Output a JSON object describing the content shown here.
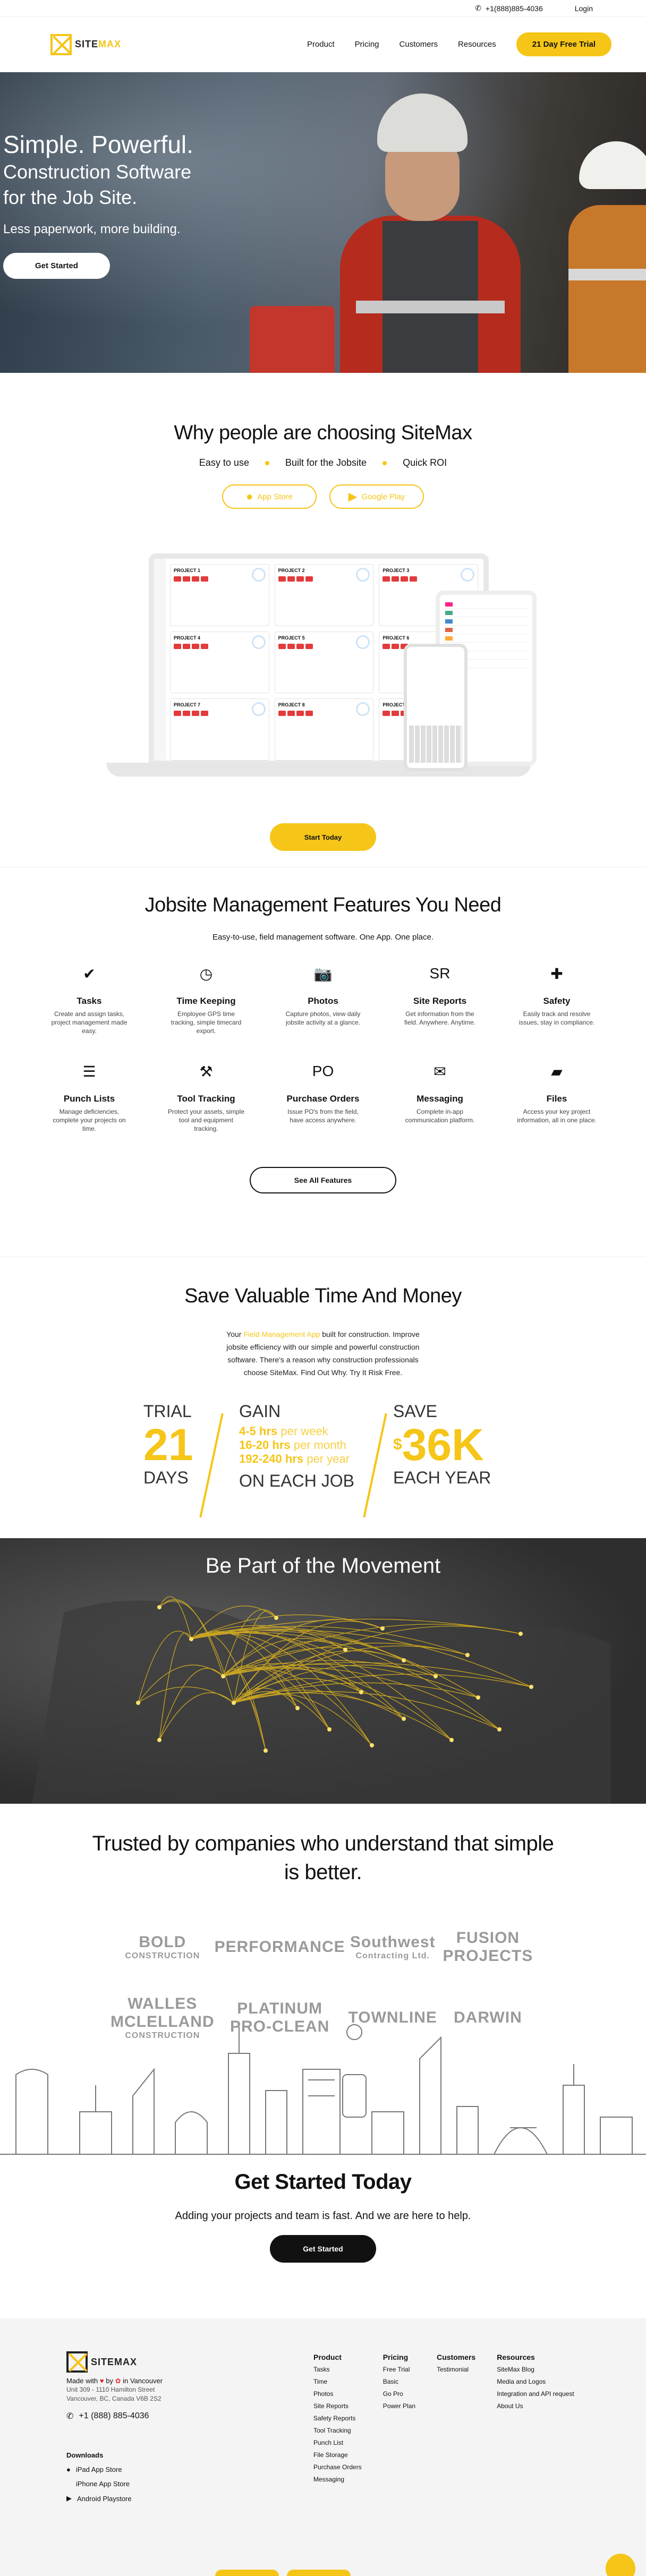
{
  "topbar": {
    "phone": "+1(888)885-4036",
    "login": "Login"
  },
  "nav": {
    "logo_text_a": "SITE",
    "logo_text_b": "MAX",
    "items": [
      "Product",
      "Pricing",
      "Customers",
      "Resources"
    ],
    "cta": "21 Day Free Trial"
  },
  "hero": {
    "title": "Simple. Powerful.",
    "subtitle_1": "Construction Software",
    "subtitle_2": "for the Job Site.",
    "tagline": "Less paperwork, more building.",
    "cta": "Get Started"
  },
  "why": {
    "title": "Why people are choosing SiteMax",
    "bullets": [
      "Easy to use",
      "Built for the Jobsite",
      "Quick ROI"
    ],
    "stores": [
      {
        "icon": "apple-icon",
        "label": "App Store"
      },
      {
        "icon": "google-play-icon",
        "label": "Google Play"
      }
    ],
    "project_cards": [
      "PROJECT 1",
      "PROJECT 2",
      "PROJECT 3",
      "PROJECT 4",
      "PROJECT 5",
      "PROJECT 6",
      "PROJECT 7",
      "PROJECT 8",
      "PROJECT 9"
    ],
    "cta": "Start Today"
  },
  "features": {
    "title": "Jobsite Management Features You Need",
    "lead": "Easy-to-use, field management software. One App. One place.",
    "items": [
      {
        "icon": "tasks-icon",
        "glyph": "✔",
        "name": "Tasks",
        "desc": "Create and assign tasks, project management made easy."
      },
      {
        "icon": "clock-icon",
        "glyph": "◷",
        "name": "Time Keeping",
        "desc": "Employee GPS time tracking, simple timecard export."
      },
      {
        "icon": "camera-icon",
        "glyph": "📷",
        "name": "Photos",
        "desc": "Capture photos, view daily jobsite activity at a glance."
      },
      {
        "icon": "site-reports-icon",
        "glyph": "SR",
        "name": "Site Reports",
        "desc": "Get information from the field. Anywhere. Anytime."
      },
      {
        "icon": "safety-icon",
        "glyph": "✚",
        "name": "Safety",
        "desc": "Easily track and resolve issues, stay in compliance."
      },
      {
        "icon": "punch-list-icon",
        "glyph": "☰",
        "name": "Punch Lists",
        "desc": "Manage deficiencies, complete your projects on time."
      },
      {
        "icon": "drill-icon",
        "glyph": "⚒",
        "name": "Tool Tracking",
        "desc": "Protect your assets, simple tool and equipment tracking."
      },
      {
        "icon": "purchase-order-icon",
        "glyph": "PO",
        "name": "Purchase Orders",
        "desc": "Issue PO's from the field, have access anywhere."
      },
      {
        "icon": "chat-icon",
        "glyph": "✉",
        "name": "Messaging",
        "desc": "Complete in-app communication platform."
      },
      {
        "icon": "folder-icon",
        "glyph": "▰",
        "name": "Files",
        "desc": "Access your key project information, all in one place."
      }
    ],
    "cta": "See All Features"
  },
  "save": {
    "title": "Save Valuable Time And Money",
    "para_pre": "Your ",
    "para_link": "Field Management App",
    "para_post": " built for construction. Improve jobsite efficiency with our simple and powerful construction software. There's a reason why construction professionals choose SiteMax. Find Out Why. Try It Risk Free.",
    "trial": {
      "label": "TRIAL",
      "value": "21",
      "foot": "DAYS"
    },
    "gain": {
      "label": "GAIN",
      "lines": [
        [
          "4-5 hrs",
          "per week"
        ],
        [
          "16-20 hrs",
          "per month"
        ],
        [
          "192-240 hrs",
          "per year"
        ]
      ],
      "foot": "ON EACH JOB"
    },
    "save": {
      "label": "SAVE",
      "currency": "$",
      "value": "36K",
      "foot": "EACH YEAR"
    }
  },
  "movement": {
    "title": "Be Part of the Movement"
  },
  "trusted": {
    "title": "Trusted by companies who understand that simple is better.",
    "logos": [
      {
        "name": "BOLD",
        "sub": "CONSTRUCTION"
      },
      {
        "name": "PERFORMANCE",
        "sub": ""
      },
      {
        "name": "Southwest",
        "sub": "Contracting Ltd."
      },
      {
        "name": "FUSION PROJECTS",
        "sub": ""
      },
      {
        "name": "WALLES MCLELLAND",
        "sub": "CONSTRUCTION"
      },
      {
        "name": "PLATINUM PRO-CLEAN",
        "sub": ""
      },
      {
        "name": "TOWNLINE",
        "sub": ""
      },
      {
        "name": "DARWIN",
        "sub": ""
      }
    ]
  },
  "getstarted": {
    "title": "Get Started Today",
    "text": "Adding your projects and team is fast. And we are here to help.",
    "cta": "Get Started"
  },
  "footer": {
    "made": "Made with",
    "by": "by",
    "in": "in Vancouver",
    "addr_1": "Unit 309 - 1110 Hamilton Street",
    "addr_2": "Vancouver, BC, Canada V6B 2S2",
    "phone": "+1 (888) 885-4036",
    "downloads_title": "Downloads",
    "downloads": [
      "iPad App Store",
      "iPhone App Store",
      "Android Playstore"
    ],
    "columns": [
      {
        "title": "Product",
        "links": [
          "Tasks",
          "Time",
          "Photos",
          "Site Reports",
          "Safety Reports",
          "Tool Tracking",
          "Punch List",
          "File Storage",
          "Purchase Orders",
          "Messaging"
        ]
      },
      {
        "title": "Pricing",
        "links": [
          "Free Trial",
          "Basic",
          "Go Pro",
          "Power Plan"
        ]
      },
      {
        "title": "Customers",
        "links": [
          "Testimonial"
        ]
      },
      {
        "title": "Resources",
        "links": [
          "SiteMax Blog",
          "Media and Logos",
          "Integration and API request",
          "About Us"
        ]
      }
    ]
  },
  "colors": {
    "accent": "#f5c518",
    "dark": "#111111"
  }
}
